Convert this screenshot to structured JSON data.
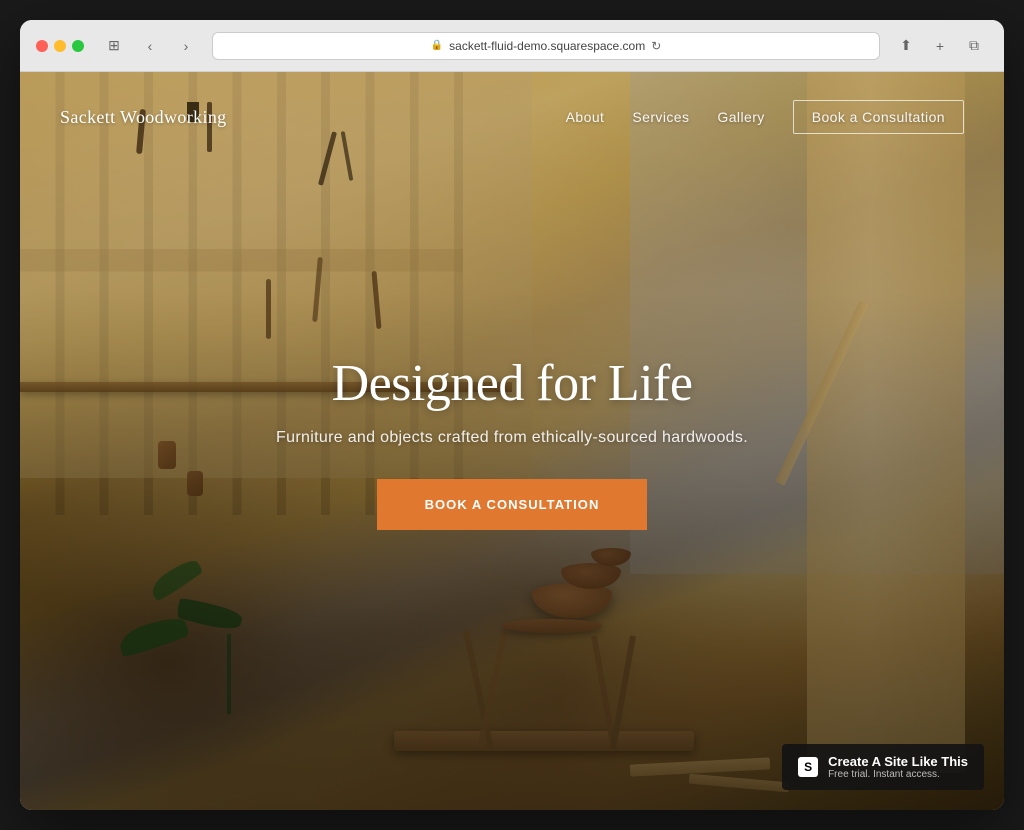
{
  "browser": {
    "url": "sackett-fluid-demo.squarespace.com",
    "reload_icon": "↻"
  },
  "nav": {
    "brand": "Sackett Woodworking",
    "links": [
      {
        "label": "About",
        "id": "about"
      },
      {
        "label": "Services",
        "id": "services"
      },
      {
        "label": "Gallery",
        "id": "gallery"
      },
      {
        "label": "Book a Consultation",
        "id": "book-nav"
      }
    ]
  },
  "hero": {
    "title": "Designed for Life",
    "subtitle": "Furniture and objects crafted from ethically-sourced hardwoods.",
    "cta_label": "Book a Consultation"
  },
  "badge": {
    "main": "Create A Site Like This",
    "sub": "Free trial. Instant access.",
    "logo": "S"
  }
}
